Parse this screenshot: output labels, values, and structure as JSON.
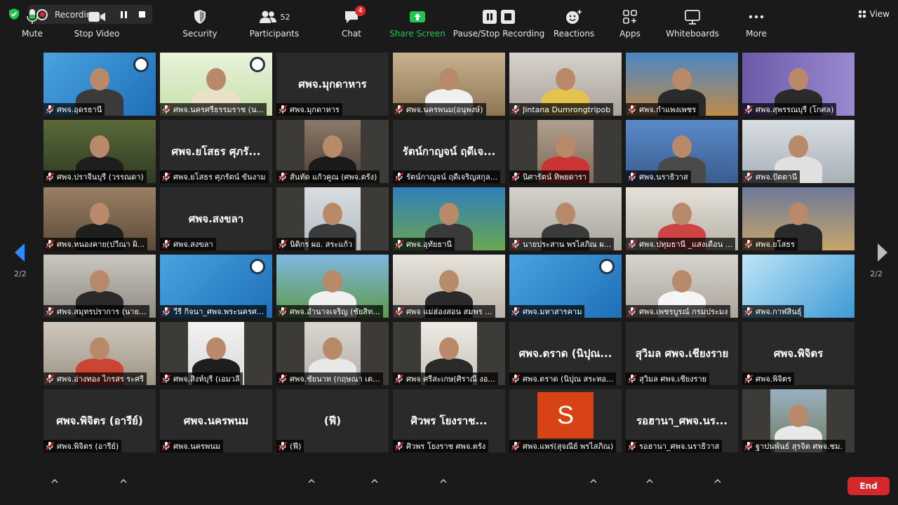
{
  "recording": {
    "label": "Recording..."
  },
  "view": {
    "label": "View"
  },
  "pagination": {
    "left": "2/2",
    "right": "2/2"
  },
  "tiles": [
    {
      "big": "",
      "name": "ศพจ.อุดรธานี"
    },
    {
      "big": "",
      "name": "ศพจ.นครศรีธรรมราช (น..."
    },
    {
      "big": "ศพจ.มุกดาหาร",
      "name": "ศพจ.มุกดาหาร"
    },
    {
      "big": "",
      "name": "ศพจ.นครพนม(อนุพงษ์)"
    },
    {
      "big": "",
      "name": "Jintana Dumrongtripob"
    },
    {
      "big": "",
      "name": "ศพจ.กำแพงเพชร"
    },
    {
      "big": "",
      "name": "ศพจ.สุพรรณบุรี (โกศล)"
    },
    {
      "big": "",
      "name": "ศพจ.ปราจีนบุรี (วรรณดา)"
    },
    {
      "big": "ศพจ.ยโสธร ศุภรั...",
      "name": "ศพจ.ยโสธร ศุภรัตน์ ขันงาม"
    },
    {
      "big": "",
      "name": "สันทัด แก้วคูณ (ศพจ.ตรัง)"
    },
    {
      "big": "รัตน์กาญจน์ ฤดีเจ...",
      "name": "รัตน์กาญจน์ ฤดีเจริญสกุล..."
    },
    {
      "big": "",
      "name": "นิศารัตน์ ทิพยดารา"
    },
    {
      "big": "",
      "name": "ศพจ.นราธิวาส"
    },
    {
      "big": "",
      "name": "ศพจ.ปัตตานี"
    },
    {
      "big": "",
      "name": "ศพจ.หนองคาย(ปวีณา ผิ..."
    },
    {
      "big": "ศพจ.สงขลา",
      "name": "ศพจ.สงขลา"
    },
    {
      "big": "",
      "name": "นิติกร ผอ. สระแก้ว"
    },
    {
      "big": "",
      "name": "ศพจ.อุทัยธานี"
    },
    {
      "big": "",
      "name": "นายประสาน พรไสภิณ ผ..."
    },
    {
      "big": "",
      "name": "ศพจ.ปทุมธานี _แสงเดือน ..."
    },
    {
      "big": "",
      "name": "ศพจ.ยโสธร"
    },
    {
      "big": "",
      "name": "ศพจ.สมุทรปราการ (นาย..."
    },
    {
      "big": "",
      "name": "วีรี กิจนา_ศพจ.พระนครศ..."
    },
    {
      "big": "",
      "name": "ศพจ.อำนาจเจริญ (ชัยสิท..."
    },
    {
      "big": "",
      "name": "ศพจ แม่ฮ่องสอน สมพร ..."
    },
    {
      "big": "",
      "name": "ศพจ.มหาสารคาม"
    },
    {
      "big": "",
      "name": "ศพจ.เพชรบูรณ์ กรมประมง"
    },
    {
      "big": "",
      "name": "ศพจ.กาฬสินธุ์"
    },
    {
      "big": "",
      "name": "ศพจ.อ่างทอง ไกรสร ระศรี"
    },
    {
      "big": "",
      "name": "ศพจ.สิงห์บุรี (เอมวลี"
    },
    {
      "big": "",
      "name": "ศพจ.ชัยนาท (กฤษณา เต..."
    },
    {
      "big": "",
      "name": "ศพจ ศรีสะเกษ(ศิราณี งอ..."
    },
    {
      "big": "ศพจ.ตราด (นิปุณ...",
      "name": "ศพจ.ตราด (นิปุณ สระทอ..."
    },
    {
      "big": "สุวิมล ศพจ.เชียงราย",
      "name": "สุวิมล ศพจ.เชียงราย"
    },
    {
      "big": "ศพจ.พิจิตร",
      "name": "ศพจ.พิจิตร"
    },
    {
      "big": "ศพจ.พิจิตร (อารีย์)",
      "name": "ศพจ.พิจิตร (อารีย์)"
    },
    {
      "big": "ศพจ.นครพนม",
      "name": "ศพจ.นครพนม"
    },
    {
      "big": "(ฟี)",
      "name": "(ฟี)"
    },
    {
      "big": "ศิวพร โยงราช...",
      "name": "ศิวพร โยงราช ศพจ.ตรัง"
    },
    {
      "big": "",
      "name": "ศพจ.แพร่(สุจณีย์ พรไสภิณ)"
    },
    {
      "big": "รอฮานา_ศพจ.นร...",
      "name": "รอฮานา_ศพจ.นราธิวาส"
    },
    {
      "big": "",
      "name": "ฐาปนพันธ์ สุรจิต ศพจ.ชม."
    }
  ],
  "avatar_letter": "S",
  "toolbar": {
    "mute": "Mute",
    "stop_video": "Stop Video",
    "security": "Security",
    "participants": "Participants",
    "participants_count": "52",
    "chat": "Chat",
    "chat_badge": "4",
    "share_screen": "Share Screen",
    "pause_stop_recording": "Pause/Stop Recording",
    "reactions": "Reactions",
    "apps": "Apps",
    "whiteboards": "Whiteboards",
    "more": "More",
    "end": "End"
  },
  "colors": {
    "accent_green": "#23c552",
    "end_red": "#d4282c",
    "badge_red": "#e02828",
    "avatar_orange": "#d84315"
  }
}
